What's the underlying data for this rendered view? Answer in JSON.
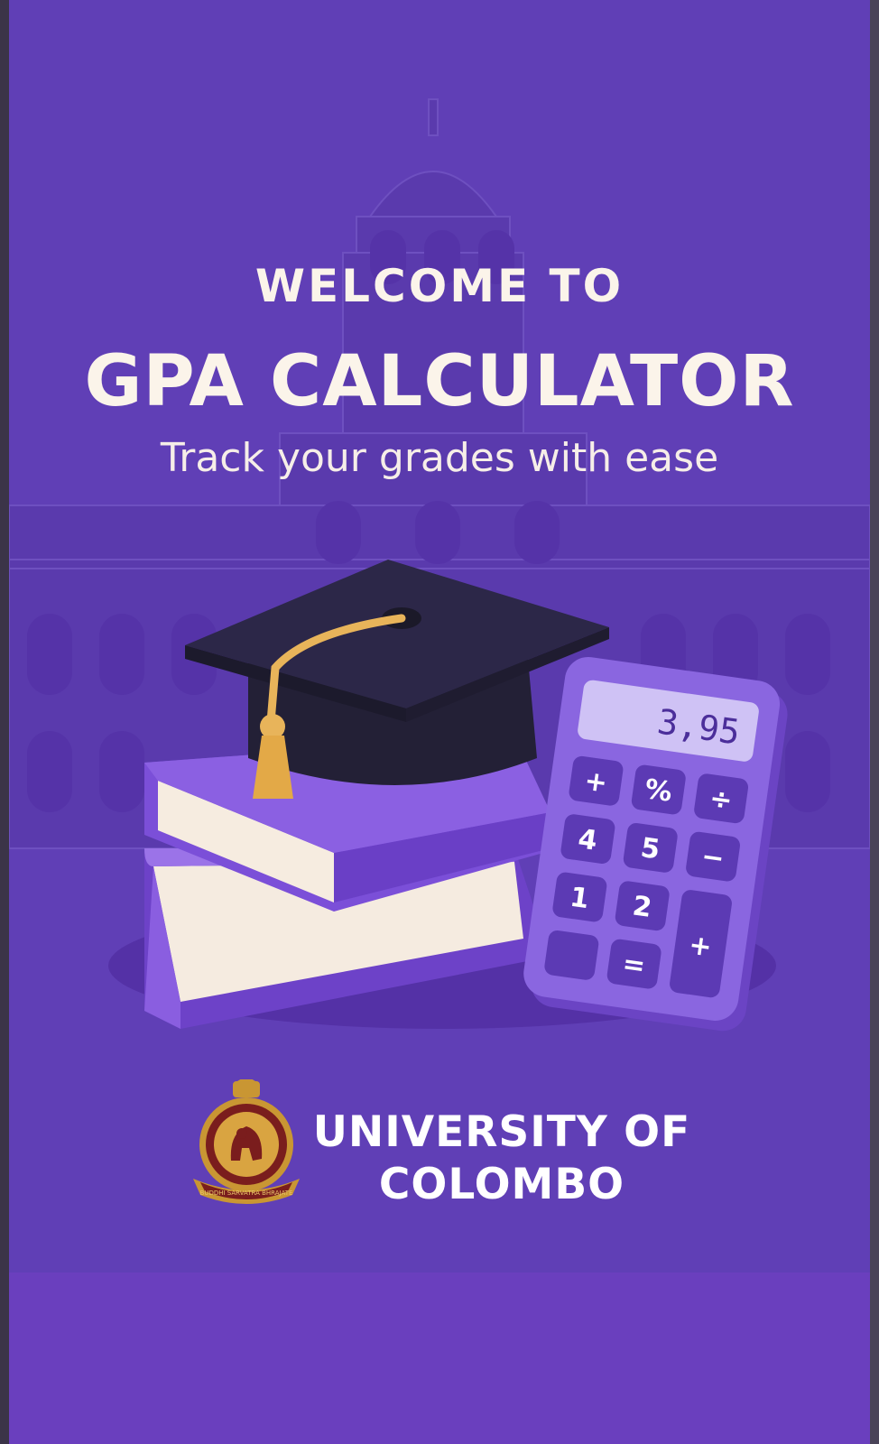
{
  "splash": {
    "welcome": "WELCOME TO",
    "title": "GPA CALCULATOR",
    "tagline": "Track your grades with ease"
  },
  "calculator": {
    "display": "3,95",
    "keys": [
      "+",
      "%",
      "÷",
      "4",
      "5",
      "−",
      "1",
      "2",
      "+",
      "",
      "="
    ]
  },
  "university": {
    "line1": "UNIVERSITY OF",
    "line2": "COLOMBO",
    "crest_motto": "BUDDHI SARVATRA BHRAJATE"
  },
  "colors": {
    "background": "#603fb6",
    "text": "#fbf4ea",
    "cap": "#2a2546",
    "tassel": "#e8b45a",
    "book": "#7a4fd6",
    "calculator": "#8a66e0"
  }
}
